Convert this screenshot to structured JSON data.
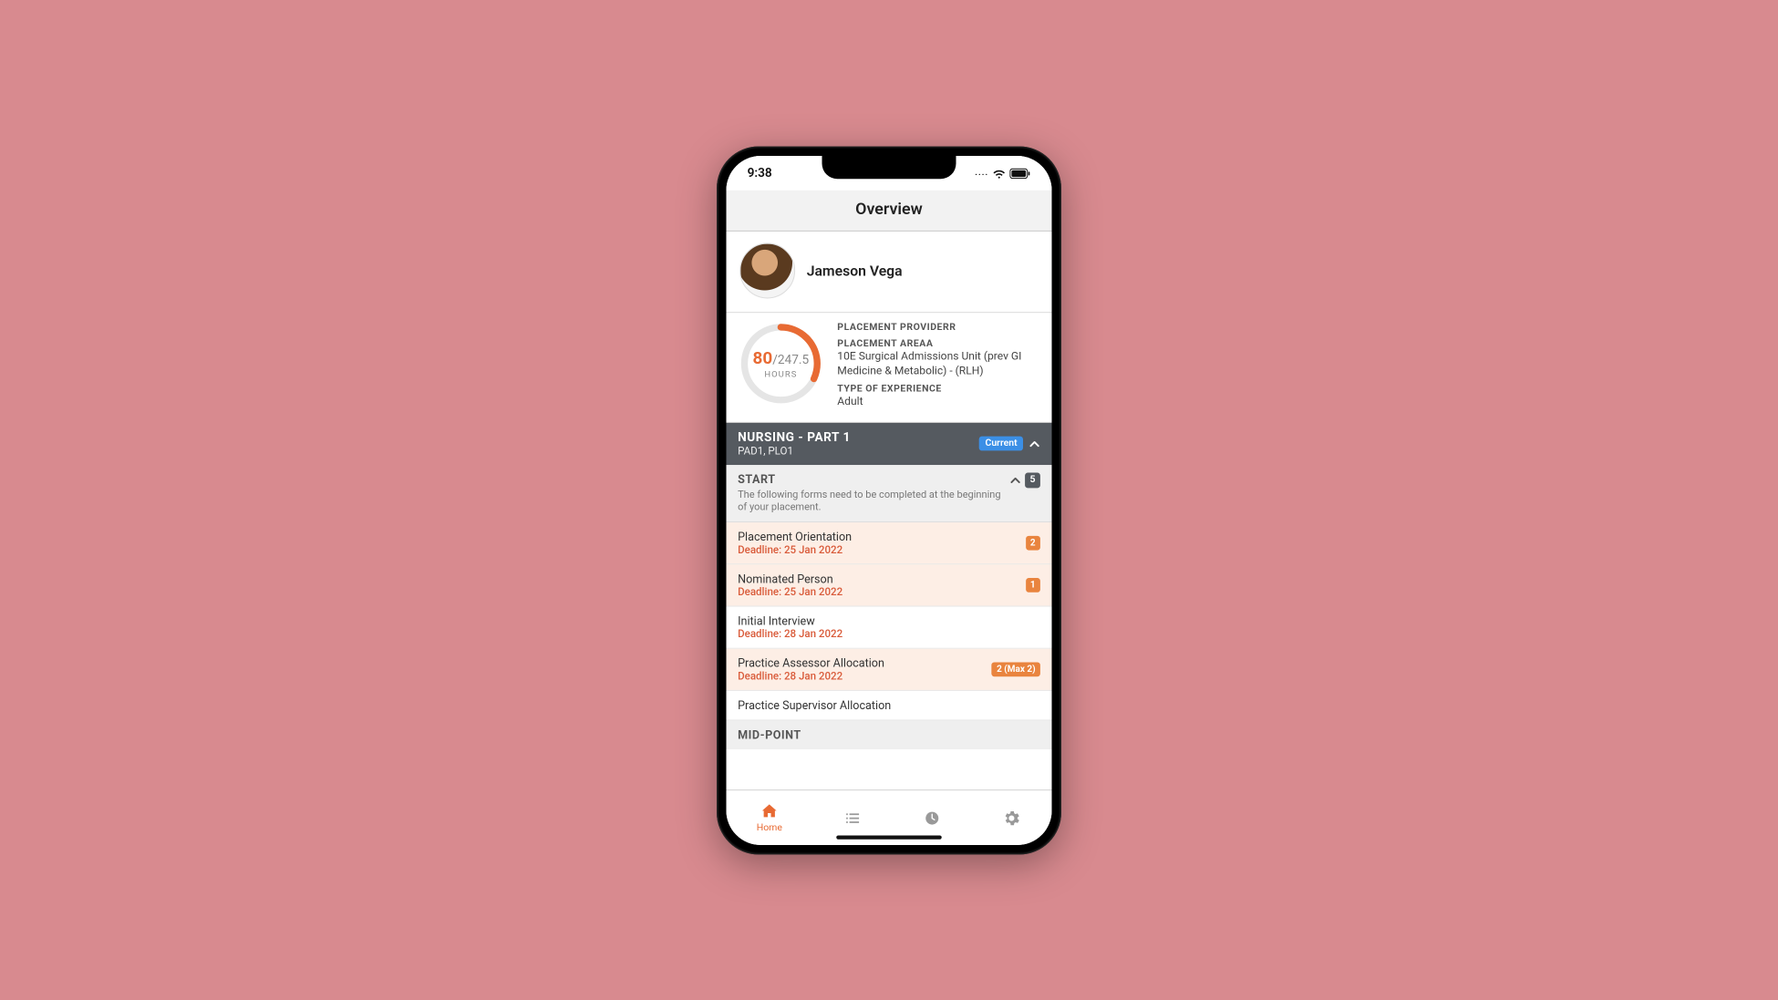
{
  "statusBar": {
    "time": "9:38"
  },
  "header": {
    "title": "Overview"
  },
  "profile": {
    "name": "Jameson Vega"
  },
  "hours": {
    "completed": "80",
    "total": "/247.5",
    "label": "HOURS",
    "percent": 32
  },
  "placement": {
    "providerLabel": "PLACEMENT PROVIDERR",
    "areaLabel": "PLACEMENT AREAA",
    "areaValue": "10E Surgical Admissions Unit (prev GI Medicine & Metabolic) - (RLH)",
    "typeLabel": "TYPE OF EXPERIENCE",
    "typeValue": "Adult"
  },
  "section": {
    "title": "NURSING - PART 1",
    "sub": "PAD1, PLO1",
    "status": "Current"
  },
  "start": {
    "title": "START",
    "desc": "The following forms need to be completed at the beginning of your placement.",
    "count": "5"
  },
  "forms": [
    {
      "name": "Placement Orientation",
      "deadline": "Deadline: 25 Jan 2022",
      "badge": "2",
      "hl": true
    },
    {
      "name": "Nominated Person",
      "deadline": "Deadline: 25 Jan 2022",
      "badge": "1",
      "hl": true
    },
    {
      "name": "Initial Interview",
      "deadline": "Deadline: 28 Jan 2022",
      "badge": "",
      "hl": false
    },
    {
      "name": "Practice Assessor Allocation",
      "deadline": "Deadline: 28 Jan 2022",
      "badge": "2 (Max 2)",
      "hl": true
    },
    {
      "name": "Practice Supervisor Allocation",
      "deadline": "",
      "badge": "",
      "hl": false
    }
  ],
  "midpoint": {
    "title": "MID-POINT"
  },
  "tabs": {
    "home": "Home"
  }
}
